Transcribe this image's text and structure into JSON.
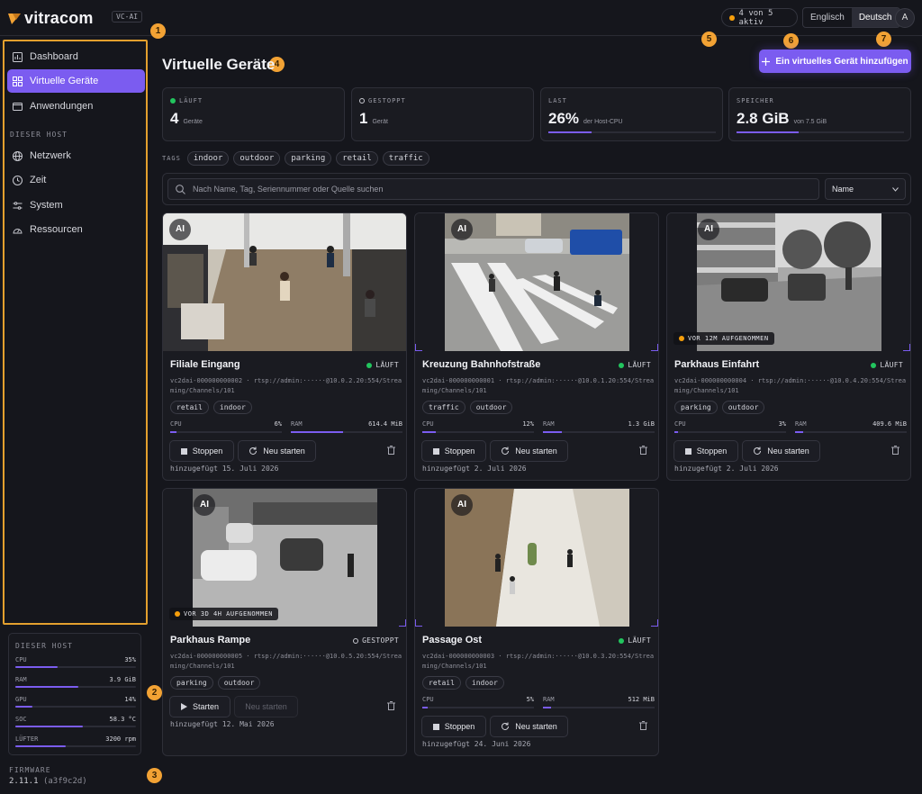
{
  "header": {
    "logo_text": "vitracom",
    "badge": "VC-AI",
    "active_status": "4 von 5 aktiv",
    "languages": [
      "Englisch",
      "Deutsch"
    ],
    "selected_language": "Deutsch",
    "avatar_initial": "A"
  },
  "markers": [
    "1",
    "2",
    "3",
    "4",
    "5",
    "6",
    "7"
  ],
  "sidebar": {
    "items": [
      {
        "label": "Dashboard",
        "icon": "bar-chart-icon"
      },
      {
        "label": "Virtuelle Geräte",
        "icon": "grid-icon",
        "active": true
      },
      {
        "label": "Anwendungen",
        "icon": "window-icon"
      }
    ],
    "section_title": "DIESER HOST",
    "host_items": [
      {
        "label": "Netzwerk",
        "icon": "globe-icon"
      },
      {
        "label": "Zeit",
        "icon": "clock-icon"
      },
      {
        "label": "System",
        "icon": "sliders-icon"
      },
      {
        "label": "Ressourcen",
        "icon": "gauge-icon"
      }
    ]
  },
  "host_stats": {
    "title": "DIESER HOST",
    "rows": [
      {
        "label": "CPU",
        "value": "35%",
        "fraction": 0.35
      },
      {
        "label": "RAM",
        "value": "3.9 GiB",
        "fraction": 0.52
      },
      {
        "label": "GPU",
        "value": "14%",
        "fraction": 0.14
      },
      {
        "label": "SOC",
        "value": "58.3 °C",
        "fraction": 0.56
      },
      {
        "label": "LÜFTER",
        "value": "3200 rpm",
        "fraction": 0.42
      }
    ]
  },
  "firmware": {
    "title": "FIRMWARE",
    "version": "2.11.1",
    "hash": "(a3f9c2d)"
  },
  "main": {
    "title": "Virtuelle Geräte",
    "add_button": "Ein virtuelles Gerät hinzufügen"
  },
  "stats": [
    {
      "label": "LÄUFT",
      "value": "4",
      "sub": "Geräte",
      "indicator": "green-dot"
    },
    {
      "label": "GESTOPPT",
      "value": "1",
      "sub": "Gerät",
      "indicator": "ring"
    },
    {
      "label": "LAST",
      "value": "26%",
      "sub": "der Host-CPU",
      "bar": 0.26
    },
    {
      "label": "SPEICHER",
      "value": "2.8 GiB",
      "sub": "von 7.5 GiB",
      "bar": 0.37
    }
  ],
  "tags": {
    "label": "TAGS",
    "items": [
      "indoor",
      "outdoor",
      "parking",
      "retail",
      "traffic"
    ]
  },
  "search": {
    "placeholder": "Nach Name, Tag, Seriennummer oder Quelle suchen",
    "sort": "Name"
  },
  "colors": {
    "accent": "#7b5cf0",
    "running": "#22c55e",
    "recording": "#f59e0b",
    "marker": "#f2a234"
  },
  "devices": [
    {
      "name": "Filiale Eingang",
      "status": "LÄUFT",
      "running": true,
      "serial": "vc2dai-000000000002",
      "url": "rtsp://admin:······@10.0.2.20:554/Streaming/Channels/101",
      "tags": [
        "retail",
        "indoor"
      ],
      "cpu": "6%",
      "cpu_f": 0.06,
      "ram": "614.4 MiB",
      "ram_f": 0.47,
      "buttons": [
        "Stoppen",
        "Neu starten"
      ],
      "date": "hinzugefügt 15. Juli 2026",
      "scene": "store"
    },
    {
      "name": "Kreuzung Bahnhofstraße",
      "status": "LÄUFT",
      "running": true,
      "serial": "vc2dai-000000000001",
      "url": "rtsp://admin:······@10.0.1.20:554/Streaming/Channels/101",
      "tags": [
        "traffic",
        "outdoor"
      ],
      "cpu": "12%",
      "cpu_f": 0.12,
      "ram": "1.3 GiB",
      "ram_f": 0.17,
      "buttons": [
        "Stoppen",
        "Neu starten"
      ],
      "date": "hinzugefügt 2. Juli 2026",
      "scene": "street"
    },
    {
      "name": "Parkhaus Einfahrt",
      "status": "LÄUFT",
      "running": true,
      "serial": "vc2dai-000000000004",
      "url": "rtsp://admin:······@10.0.4.20:554/Streaming/Channels/101",
      "tags": [
        "parking",
        "outdoor"
      ],
      "cpu": "3%",
      "cpu_f": 0.03,
      "ram": "409.6 MiB",
      "ram_f": 0.07,
      "buttons": [
        "Stoppen",
        "Neu starten"
      ],
      "date": "hinzugefügt 2. Juli 2026",
      "recorded": "VOR 12M AUFGENOMMEN",
      "scene": "parking"
    },
    {
      "name": "Parkhaus Rampe",
      "status": "GESTOPPT",
      "running": false,
      "serial": "vc2dai-000000000005",
      "url": "rtsp://admin:······@10.0.5.20:554/Streaming/Channels/101",
      "tags": [
        "parking",
        "outdoor"
      ],
      "buttons": [
        "Starten",
        "Neu starten"
      ],
      "date": "hinzugefügt 12. Mai 2026",
      "recorded": "VOR 3D 4H AUFGENOMMEN",
      "scene": "garage"
    },
    {
      "name": "Passage Ost",
      "status": "LÄUFT",
      "running": true,
      "serial": "vc2dai-000000000003",
      "url": "rtsp://admin:······@10.0.3.20:554/Streaming/Channels/101",
      "tags": [
        "retail",
        "indoor"
      ],
      "cpu": "5%",
      "cpu_f": 0.05,
      "ram": "512 MiB",
      "ram_f": 0.07,
      "buttons": [
        "Stoppen",
        "Neu starten"
      ],
      "date": "hinzugefügt 24. Juni 2026",
      "scene": "mall"
    }
  ],
  "thumbnail_badge": "AI"
}
